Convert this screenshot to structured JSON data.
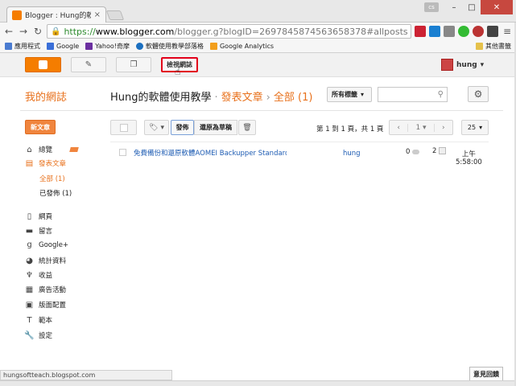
{
  "browser": {
    "tab_title": "Blogger : Hung的軟體使",
    "tab_close": "×",
    "profile_badge": "cs",
    "url_scheme": "https://",
    "url_host": "www.blogger.com",
    "url_path": "/blogger.g?blogID=2697845874563658378#allposts",
    "bookmarks": [
      "應用程式",
      "Google",
      "Yahoo!奇摩",
      "軟體使用教學部落格",
      "Google Analytics"
    ],
    "bookmarks_other": "其他書籤",
    "status_url": "hungsoftteach.blogspot.com"
  },
  "blogger_bar": {
    "view_blog_label": "檢視網誌",
    "user_name": "hung"
  },
  "header": {
    "blog_title": "我的網誌",
    "crumb_blog": "Hung的軟體使用教學",
    "crumb_sep": "›",
    "crumb_posts": "發表文章",
    "crumb_all": "全部 (1)",
    "label_filter": "所有標籤"
  },
  "sidebar": {
    "new_post": "新文章",
    "items": [
      {
        "label": "總覽",
        "icon": "home-icon"
      },
      {
        "label": "發表文章",
        "icon": "posts-icon"
      },
      {
        "label": "網頁",
        "icon": "pages-icon"
      },
      {
        "label": "留言",
        "icon": "comments-icon"
      },
      {
        "label": "Google+",
        "icon": "google-plus-icon"
      },
      {
        "label": "統計資料",
        "icon": "stats-icon"
      },
      {
        "label": "收益",
        "icon": "earnings-icon"
      },
      {
        "label": "廣告活動",
        "icon": "campaigns-icon"
      },
      {
        "label": "版面配置",
        "icon": "layout-icon"
      },
      {
        "label": "範本",
        "icon": "template-icon"
      },
      {
        "label": "設定",
        "icon": "settings-icon"
      }
    ],
    "sub_all": "全部 (1)",
    "sub_published": "已發佈 (1)"
  },
  "actions": {
    "publish": "發佈",
    "revert_draft": "還原為草稿",
    "page_info": "第 1 到 1 頁，共 1 頁",
    "pager_page": "1",
    "per_page": "25"
  },
  "posts": [
    {
      "title": "免費備份和還原軟體AOMEI Backupper Standard...",
      "author": "hung",
      "comments": "0",
      "views": "2",
      "date_line1": "上午",
      "date_line2": "5:58:00"
    }
  ],
  "feedback_label": "意見回饋",
  "colors": {
    "accent": "#e8711c",
    "highlight_border": "#e2001a",
    "link": "#1e5cb3"
  }
}
